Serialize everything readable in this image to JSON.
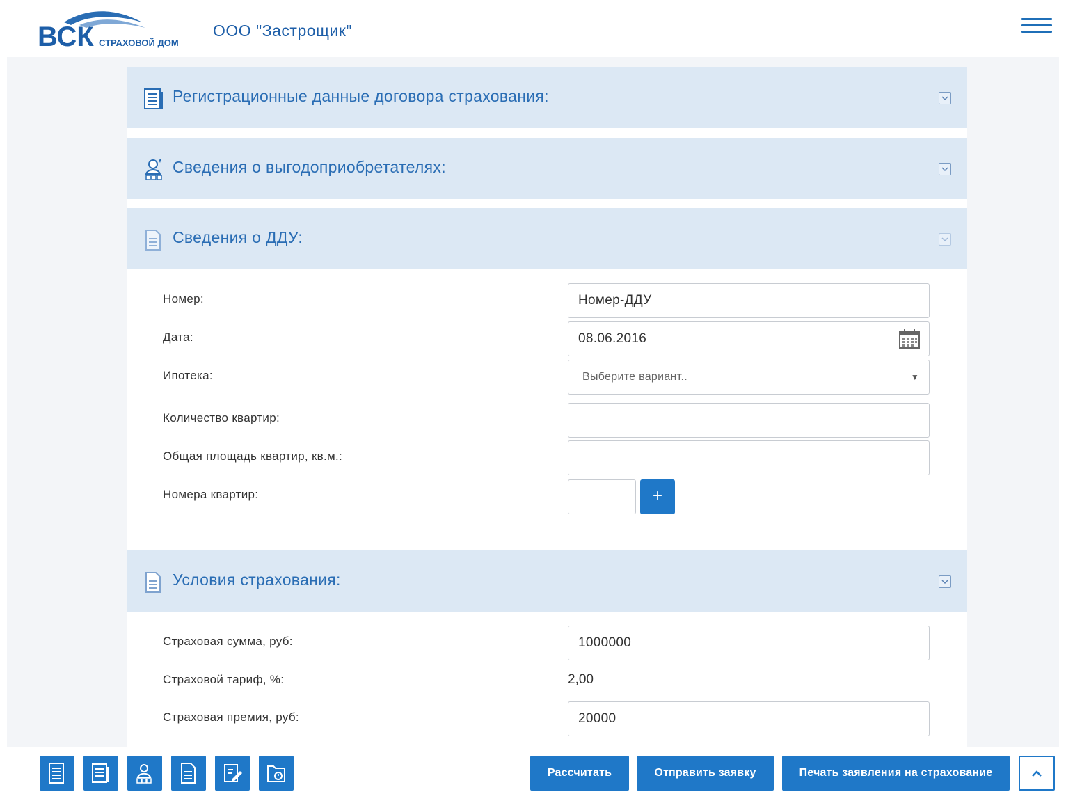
{
  "header": {
    "logo_text": "ВСК",
    "logo_subtext": "СТРАХОВОЙ ДОМ",
    "company": "ООО \"Застрощик\""
  },
  "sections": {
    "registration": {
      "title": "Регистрационные данные договора страхования:"
    },
    "beneficiaries": {
      "title": "Сведения о выгодоприобретателях:"
    },
    "ddu": {
      "title": "Сведения о ДДУ:"
    },
    "conditions": {
      "title": "Условия страхования:"
    }
  },
  "ddu_form": {
    "number_label": "Номер:",
    "number_value": "Номер-ДДУ",
    "date_label": "Дата:",
    "date_value": "08.06.2016",
    "mortgage_label": "Ипотека:",
    "mortgage_placeholder": "Выберите вариант..",
    "apartments_count_label": "Количество квартир:",
    "apartments_count_value": "",
    "total_area_label": "Общая площадь квартир, кв.м.:",
    "total_area_value": "",
    "apartment_numbers_label": "Номера квартир:",
    "add_symbol": "+"
  },
  "conditions_form": {
    "sum_label": "Страховая сумма, руб:",
    "sum_value": "1000000",
    "tariff_label": "Страховой тариф, %:",
    "tariff_value": "2,00",
    "premium_label": "Страховая премия, руб:",
    "premium_value": "20000"
  },
  "toolbar": {
    "calculate": "Рассчитать",
    "send": "Отправить заявку",
    "print": "Печать заявления на страхование"
  },
  "colors": {
    "accent": "#1f78c8",
    "section_bg": "#dce8f4",
    "section_title": "#2a6db4"
  }
}
